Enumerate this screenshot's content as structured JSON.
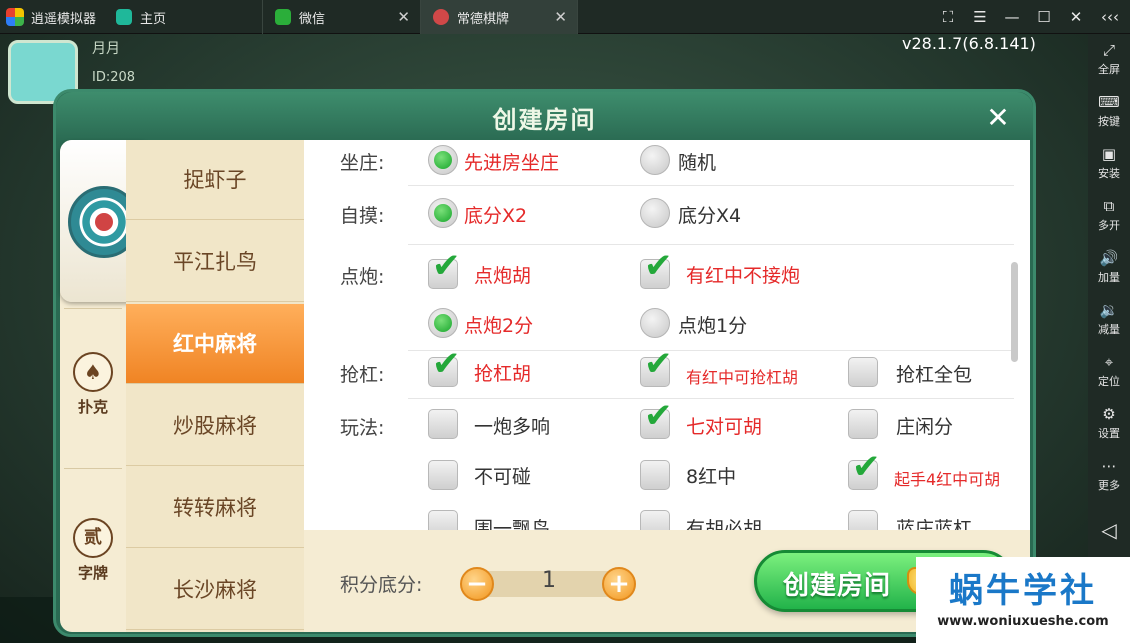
{
  "titlebar": {
    "app_title": "逍遥模拟器",
    "tabs": [
      {
        "label": "主页"
      },
      {
        "label": "微信"
      },
      {
        "label": "常德棋牌"
      }
    ],
    "close_glyph": "✕",
    "window_controls": [
      "⛶",
      "☰",
      "—",
      "☐",
      "✕",
      "‹‹‹"
    ]
  },
  "sidebar": {
    "items": [
      {
        "label": "全屏",
        "icon": "fullscreen-icon",
        "glyph": "⤢"
      },
      {
        "label": "按键",
        "icon": "keyboard-icon",
        "glyph": "⌨"
      },
      {
        "label": "安装",
        "icon": "apk-icon",
        "glyph": "▣"
      },
      {
        "label": "多开",
        "icon": "multi-instance-icon",
        "glyph": "⧉"
      },
      {
        "label": "加量",
        "icon": "volume-up-icon",
        "glyph": "🔊"
      },
      {
        "label": "减量",
        "icon": "volume-down-icon",
        "glyph": "🔉"
      },
      {
        "label": "定位",
        "icon": "location-icon",
        "glyph": "⌖"
      },
      {
        "label": "设置",
        "icon": "settings-icon",
        "glyph": "⚙"
      },
      {
        "label": "更多",
        "icon": "more-icon",
        "glyph": "⋯"
      },
      {
        "label": "",
        "icon": "back-icon",
        "glyph": "◁"
      }
    ]
  },
  "game": {
    "player_name": "月月",
    "player_id": "ID:208",
    "version": "v28.1.7(6.8.141)"
  },
  "dialog": {
    "title": "创建房间",
    "close_glyph": "✕",
    "categories": [
      {
        "label": "",
        "icon": "mahjong-emblem-icon"
      },
      {
        "label": "扑克",
        "icon": "spade-icon",
        "glyph": "♠"
      },
      {
        "label": "字牌",
        "icon": "zi-pai-icon",
        "glyph": "贰"
      }
    ],
    "games": [
      {
        "label": "捉虾子",
        "active": false
      },
      {
        "label": "平江扎鸟",
        "active": false
      },
      {
        "label": "红中麻将",
        "active": true
      },
      {
        "label": "炒股麻将",
        "active": false
      },
      {
        "label": "转转麻将",
        "active": false
      },
      {
        "label": "长沙麻将",
        "active": false
      }
    ],
    "options": {
      "zuozhuang": {
        "label": "坐庄:",
        "choices": [
          {
            "text": "先进房坐庄",
            "selected": true
          },
          {
            "text": "随机",
            "selected": false
          }
        ]
      },
      "zimo": {
        "label": "自摸:",
        "choices": [
          {
            "text": "底分X2",
            "selected": true
          },
          {
            "text": "底分X4",
            "selected": false
          }
        ]
      },
      "dianpao": {
        "label": "点炮:",
        "checks": [
          {
            "text": "点炮胡",
            "checked": true
          },
          {
            "text": "有红中不接炮",
            "checked": true
          }
        ],
        "radios": [
          {
            "text": "点炮2分",
            "selected": true
          },
          {
            "text": "点炮1分",
            "selected": false
          }
        ]
      },
      "qianggang": {
        "label": "抢杠:",
        "checks": [
          {
            "text": "抢杠胡",
            "checked": true
          },
          {
            "text": "有红中可抢杠胡",
            "checked": true
          },
          {
            "text": "抢杠全包",
            "checked": false
          }
        ]
      },
      "wanfa": {
        "label": "玩法:",
        "row1": [
          {
            "text": "一炮多响",
            "checked": false
          },
          {
            "text": "七对可胡",
            "checked": true
          },
          {
            "text": "庄闲分",
            "checked": false
          }
        ],
        "row2": [
          {
            "text": "不可碰",
            "checked": false
          },
          {
            "text": "8红中",
            "checked": false
          },
          {
            "text": "起手4红中可胡",
            "checked": true
          }
        ],
        "row3": [
          {
            "text": "围一飘鸟",
            "checked": false
          },
          {
            "text": "有胡必胡",
            "checked": false
          },
          {
            "text": "蓝庄蓝杠",
            "checked": false
          }
        ]
      }
    },
    "score": {
      "label": "积分底分:",
      "value": "1",
      "minus": "−",
      "plus": "+"
    },
    "create_button": {
      "label": "创建房间",
      "cost": "×2"
    }
  },
  "watermark": {
    "title": "蜗牛学社",
    "url": "www.woniuxueshe.com"
  }
}
